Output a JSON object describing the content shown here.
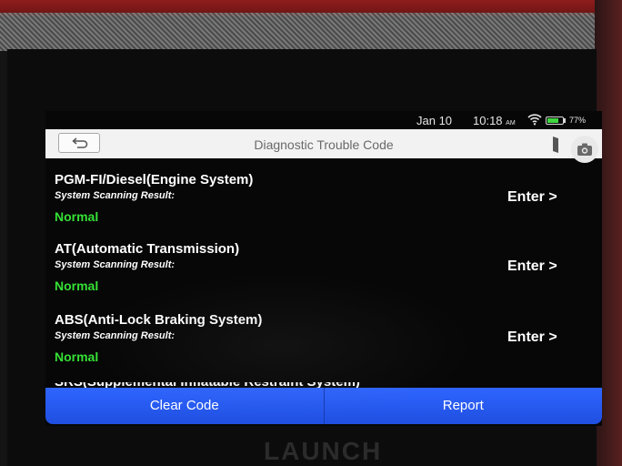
{
  "status_bar": {
    "date": "Jan 10",
    "time": "10:18",
    "ampm": "AM",
    "battery_percent_label": "77%",
    "battery_level": 0.77,
    "icons": [
      "wifi-icon",
      "battery-icon"
    ]
  },
  "title_bar": {
    "title": "Diagnostic Trouble Code",
    "back_icon": "back-arrow-icon",
    "screenshot_icon": "screenshot-icon",
    "camera_icon": "camera-icon"
  },
  "systems": [
    {
      "name": "PGM-FI/Diesel(Engine System)",
      "result_label": "System Scanning Result:",
      "status": "Normal",
      "action": "Enter >"
    },
    {
      "name": "AT(Automatic Transmission)",
      "result_label": "System Scanning Result:",
      "status": "Normal",
      "action": "Enter >"
    },
    {
      "name": "ABS(Anti-Lock Braking System)",
      "result_label": "System Scanning Result:",
      "status": "Normal",
      "action": "Enter >"
    }
  ],
  "partial_row": "SRS(Supplemental Inflatable Restraint System)",
  "buttons": {
    "clear_code": "Clear Code",
    "report": "Report"
  },
  "device_brand": "LAUNCH",
  "colors": {
    "status_normal": "#35e035",
    "button_blue": "#2f65ff",
    "battery_green": "#3fd63f"
  }
}
